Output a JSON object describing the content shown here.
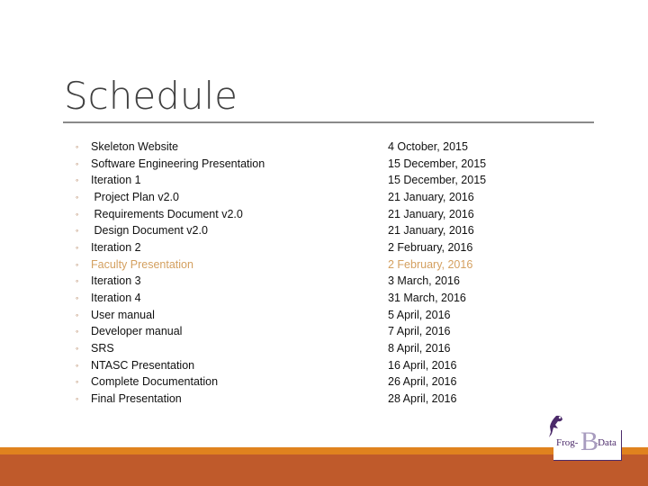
{
  "slide": {
    "title": "Schedule",
    "accent_color": "#e0821e",
    "footer_color": "#bf5a2b",
    "highlight_color": "#d4a060",
    "bullet_glyph": "◦",
    "items": [
      {
        "task": "Skeleton Website",
        "date": "4 October, 2015"
      },
      {
        "task": "Software Engineering Presentation",
        "date": "15 December, 2015"
      },
      {
        "task": "Iteration 1",
        "date": "15 December, 2015"
      },
      {
        "task": " Project Plan v2.0",
        "date": "21 January, 2016"
      },
      {
        "task": " Requirements Document v2.0",
        "date": "21 January, 2016"
      },
      {
        "task": " Design Document v2.0",
        "date": "21 January, 2016"
      },
      {
        "task": "Iteration 2",
        "date": "2 February, 2016"
      },
      {
        "task": "Faculty Presentation",
        "date": "2 February, 2016",
        "highlight": true
      },
      {
        "task": "Iteration 3",
        "date": "3 March, 2016"
      },
      {
        "task": "Iteration 4",
        "date": "31 March, 2016"
      },
      {
        "task": "User manual",
        "date": "5 April, 2016"
      },
      {
        "task": "Developer manual",
        "date": "7 April, 2016"
      },
      {
        "task": "SRS",
        "date": "8 April, 2016"
      },
      {
        "task": "NTASC Presentation",
        "date": "16 April, 2016"
      },
      {
        "task": "Complete Documentation",
        "date": "26 April, 2016"
      },
      {
        "task": "Final Presentation",
        "date": "28 April, 2016"
      }
    ]
  },
  "logo": {
    "prefix": "Frog-",
    "letter": "B",
    "suffix": "-Data",
    "icon": "frog-icon"
  }
}
